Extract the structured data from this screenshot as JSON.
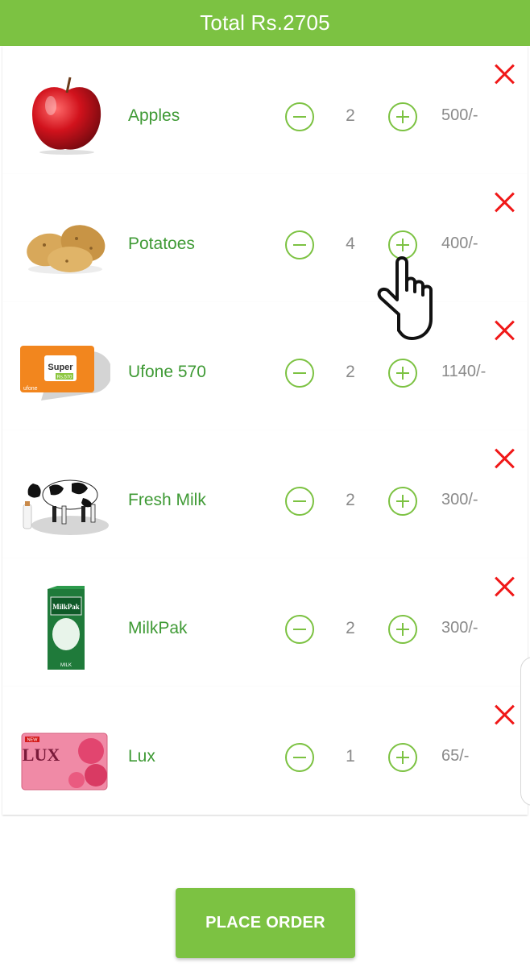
{
  "header": {
    "title": "Total Rs.2705"
  },
  "items": [
    {
      "name": "Apples",
      "qty": "2",
      "price": "500/-",
      "thumb_icon": "apple-image"
    },
    {
      "name": "Potatoes",
      "qty": "4",
      "price": "400/-",
      "thumb_icon": "potatoes-image"
    },
    {
      "name": "Ufone 570",
      "qty": "2",
      "price": "1140/-",
      "thumb_icon": "ufone-card-image",
      "card_label": "Super",
      "card_sub": "Rs.570",
      "card_brand": "ufone"
    },
    {
      "name": "Fresh Milk",
      "qty": "2",
      "price": "300/-",
      "thumb_icon": "cow-milk-image"
    },
    {
      "name": "MilkPak",
      "qty": "2",
      "price": "300/-",
      "thumb_icon": "milkpak-carton-image",
      "carton_label": "MilkPak",
      "carton_sub": "MILK"
    },
    {
      "name": "Lux",
      "qty": "1",
      "price": "65/-",
      "thumb_icon": "lux-soap-image",
      "soap_label": "LUX",
      "soap_badge": "NEW"
    }
  ],
  "footer": {
    "place_order_label": "PLACE ORDER"
  },
  "colors": {
    "accent": "#7cc242",
    "name_text": "#3f9a35",
    "remove": "#f01818",
    "muted": "#8a8a8a"
  },
  "overlay": {
    "pointer_icon": "hand-pointer-icon"
  }
}
